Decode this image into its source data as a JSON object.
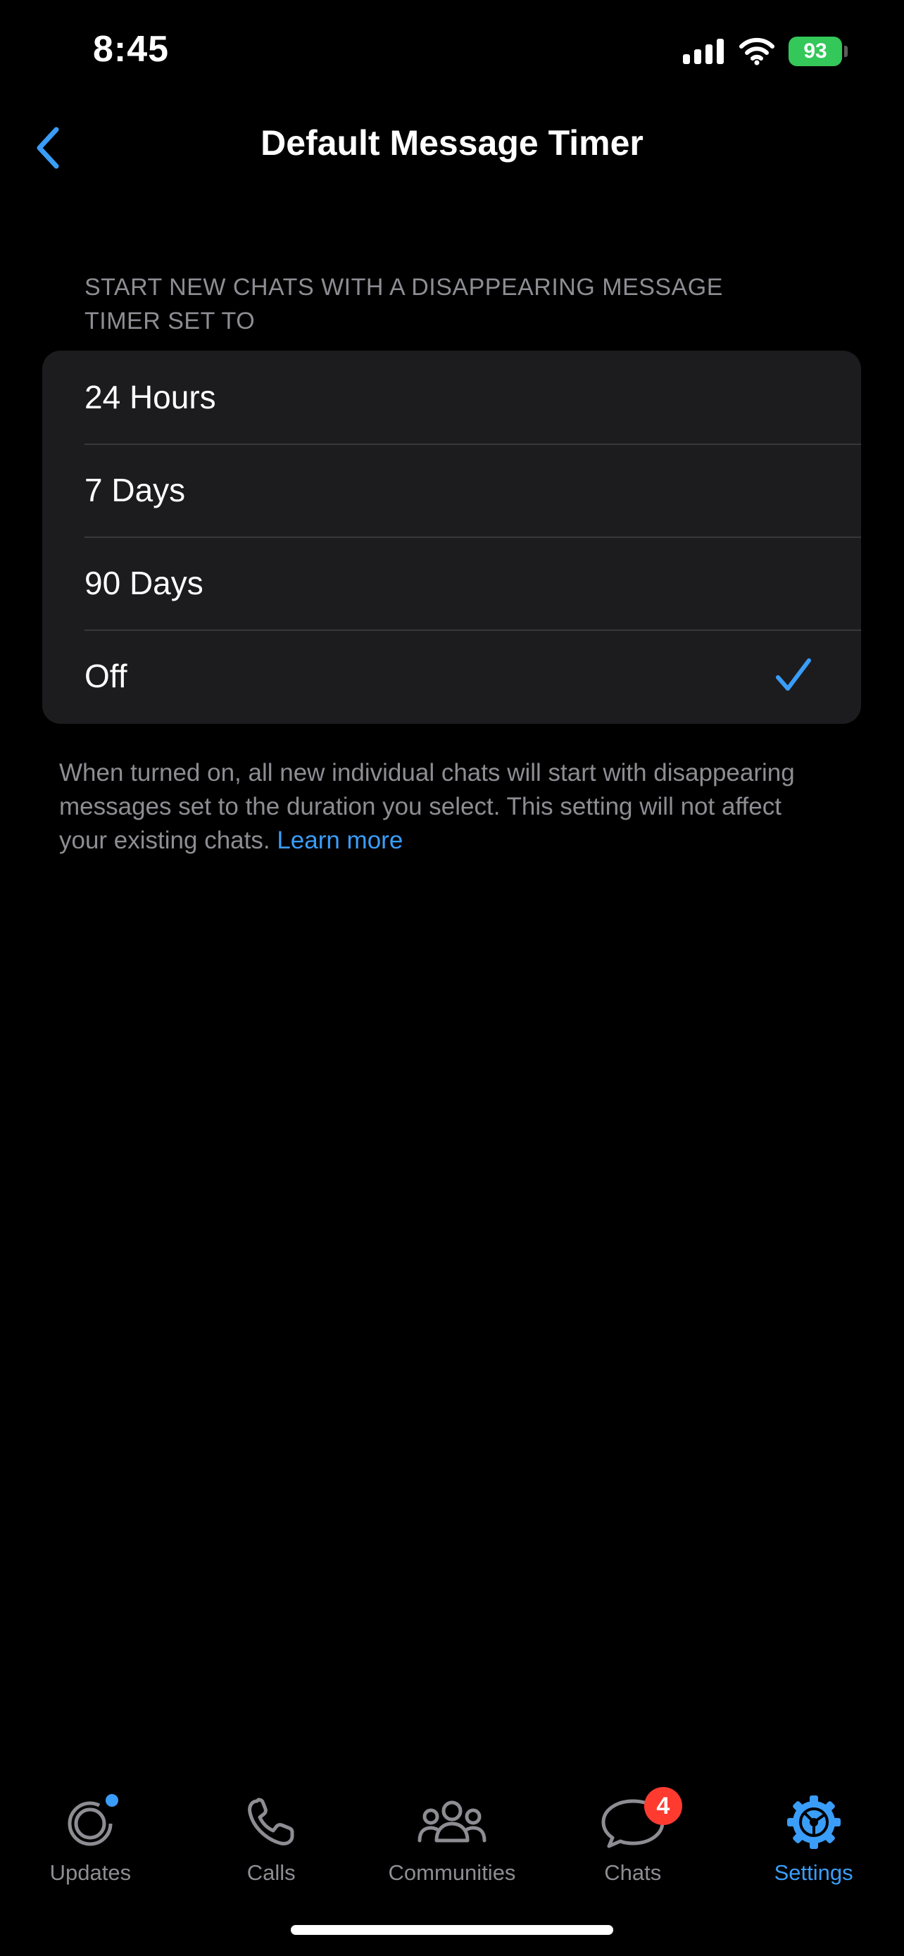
{
  "status_bar": {
    "time": "8:45",
    "battery": "93"
  },
  "nav": {
    "title": "Default Message Timer"
  },
  "section": {
    "header": "START NEW CHATS WITH A DISAPPEARING MESSAGE TIMER SET TO"
  },
  "options": [
    {
      "label": "24 Hours",
      "selected": false
    },
    {
      "label": "7 Days",
      "selected": false
    },
    {
      "label": "90 Days",
      "selected": false
    },
    {
      "label": "Off",
      "selected": true
    }
  ],
  "footer": {
    "text": "When turned on, all new individual chats will start with disappearing messages set to the duration you select. This setting will not affect your existing chats. ",
    "link_label": "Learn more"
  },
  "tabs": [
    {
      "label": "Updates",
      "icon": "updates-icon"
    },
    {
      "label": "Calls",
      "icon": "phone-icon"
    },
    {
      "label": "Communities",
      "icon": "communities-icon"
    },
    {
      "label": "Chats",
      "icon": "chat-bubble-icon",
      "badge": "4"
    },
    {
      "label": "Settings",
      "icon": "settings-gear-icon",
      "active": true
    }
  ],
  "colors": {
    "accent": "#3a9df8",
    "badge": "#ff3b30",
    "battery": "#34c759",
    "card": "#1c1c1e"
  }
}
